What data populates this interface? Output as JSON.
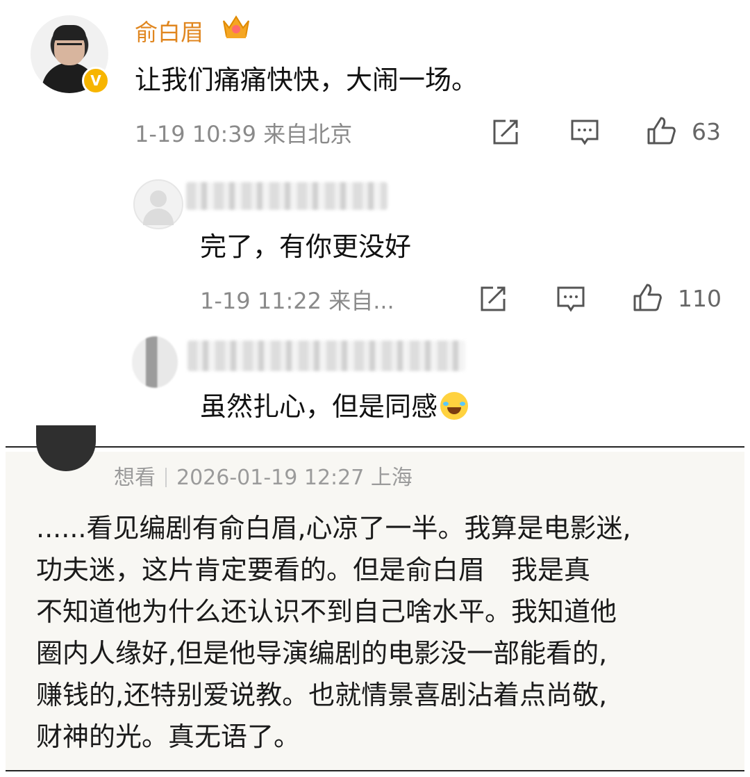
{
  "post": {
    "username": "俞白眉",
    "text": "让我们痛痛快快，大闹一场。",
    "timestamp": "1-19 10:39",
    "location": "来自北京",
    "likes": "63",
    "verified_badge": "V"
  },
  "replies": [
    {
      "text": "完了，有你更没好",
      "timestamp": "1-19 11:22",
      "location": "来自...",
      "likes": "110"
    },
    {
      "text": "虽然扎心，但是同感"
    }
  ],
  "review": {
    "status": "想看",
    "datetime": "2026-01-19 12:27",
    "location": "上海",
    "text": "......看见编剧有俞白眉,心凉了一半。我算是电影迷,\n功夫迷，这片肯定要看的。但是俞白眉　我是真\n不知道他为什么还认识不到自己啥水平。我知道他\n圈内人缘好,但是他导演编剧的电影没一部能看的,\n赚钱的,还特别爱说教。也就情景喜剧沾着点尚敬,\n财神的光。真无语了。"
  },
  "icons": [
    "edit-icon",
    "comment-icon",
    "like-icon",
    "crown-icon",
    "laugh-cry-emoji-icon"
  ],
  "colors": {
    "username": "#e0861f",
    "meta": "#8a8a8a",
    "badge": "#f7b500",
    "panel": "#f8f7f3"
  }
}
